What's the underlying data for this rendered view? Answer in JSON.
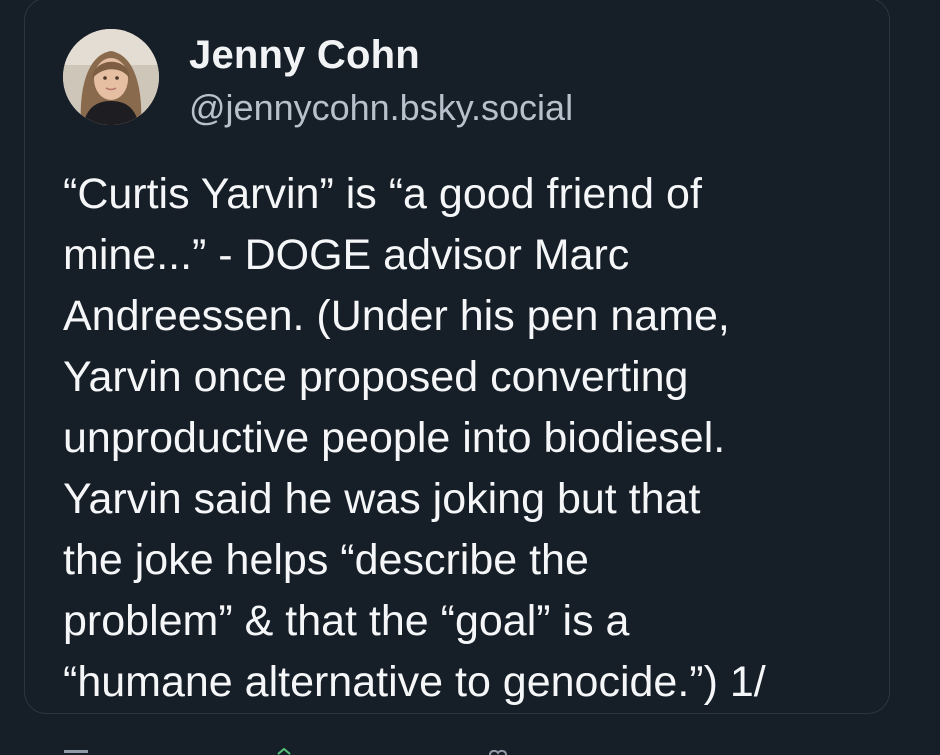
{
  "post": {
    "author_name": "Jenny Cohn",
    "author_handle": "@jennycohn.bsky.social",
    "text_lines": [
      "“Curtis Yarvin” is “a good friend of",
      "mine...” - DOGE advisor Marc",
      "Andreessen. (Under his pen name,",
      "Yarvin once proposed converting",
      "unproductive people into biodiesel.",
      "Yarvin said he was joking but that",
      "the joke helps “describe the",
      "problem” & that the “goal” is a",
      "“humane alternative to genocide.”) 1/"
    ]
  },
  "action_bar": {
    "icons": [
      "reply-icon",
      "repost-icon",
      "like-icon"
    ]
  },
  "colors": {
    "background": "#161e28",
    "text": "#f5f6f7",
    "handle": "#b7c0cb",
    "border": "#2c3642"
  }
}
